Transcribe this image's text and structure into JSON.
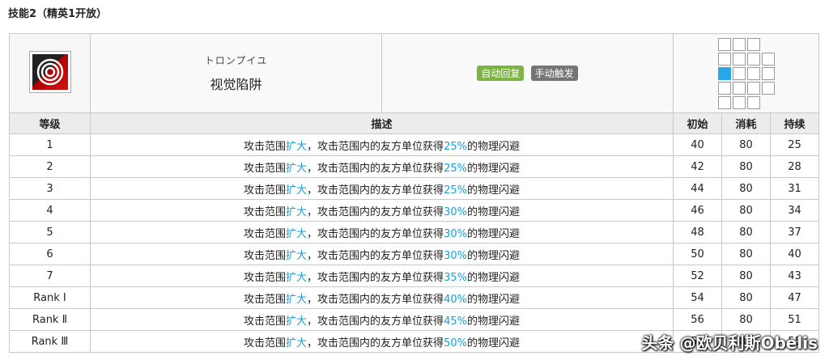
{
  "section_title": "技能2（精英1开放）",
  "skill": {
    "name_jp": "トロンプイユ",
    "name_cn": "视觉陷阱",
    "tags": [
      "自动回复",
      "手动触发"
    ]
  },
  "range_grid": [
    [
      1,
      1,
      1,
      0
    ],
    [
      1,
      1,
      1,
      1
    ],
    [
      2,
      1,
      1,
      1
    ],
    [
      1,
      1,
      1,
      1
    ],
    [
      1,
      1,
      1,
      0
    ]
  ],
  "headers": {
    "level": "等级",
    "description": "描述",
    "initial": "初始",
    "cost": "消耗",
    "duration": "持续"
  },
  "rows": [
    {
      "level": "1",
      "desc_pre": "攻击范围",
      "desc_hl1": "扩大",
      "desc_mid": "，攻击范围内的友方单位获得",
      "desc_hl2": "25%",
      "desc_post": "的物理闪避",
      "initial": "40",
      "cost": "80",
      "duration": "25"
    },
    {
      "level": "2",
      "desc_pre": "攻击范围",
      "desc_hl1": "扩大",
      "desc_mid": "，攻击范围内的友方单位获得",
      "desc_hl2": "25%",
      "desc_post": "的物理闪避",
      "initial": "42",
      "cost": "80",
      "duration": "28"
    },
    {
      "level": "3",
      "desc_pre": "攻击范围",
      "desc_hl1": "扩大",
      "desc_mid": "，攻击范围内的友方单位获得",
      "desc_hl2": "25%",
      "desc_post": "的物理闪避",
      "initial": "44",
      "cost": "80",
      "duration": "31"
    },
    {
      "level": "4",
      "desc_pre": "攻击范围",
      "desc_hl1": "扩大",
      "desc_mid": "，攻击范围内的友方单位获得",
      "desc_hl2": "30%",
      "desc_post": "的物理闪避",
      "initial": "46",
      "cost": "80",
      "duration": "34"
    },
    {
      "level": "5",
      "desc_pre": "攻击范围",
      "desc_hl1": "扩大",
      "desc_mid": "，攻击范围内的友方单位获得",
      "desc_hl2": "30%",
      "desc_post": "的物理闪避",
      "initial": "48",
      "cost": "80",
      "duration": "37"
    },
    {
      "level": "6",
      "desc_pre": "攻击范围",
      "desc_hl1": "扩大",
      "desc_mid": "，攻击范围内的友方单位获得",
      "desc_hl2": "30%",
      "desc_post": "的物理闪避",
      "initial": "50",
      "cost": "80",
      "duration": "40"
    },
    {
      "level": "7",
      "desc_pre": "攻击范围",
      "desc_hl1": "扩大",
      "desc_mid": "，攻击范围内的友方单位获得",
      "desc_hl2": "35%",
      "desc_post": "的物理闪避",
      "initial": "52",
      "cost": "80",
      "duration": "43"
    },
    {
      "level": "Rank Ⅰ",
      "desc_pre": "攻击范围",
      "desc_hl1": "扩大",
      "desc_mid": "，攻击范围内的友方单位获得",
      "desc_hl2": "40%",
      "desc_post": "的物理闪避",
      "initial": "54",
      "cost": "80",
      "duration": "47"
    },
    {
      "level": "Rank Ⅱ",
      "desc_pre": "攻击范围",
      "desc_hl1": "扩大",
      "desc_mid": "，攻击范围内的友方单位获得",
      "desc_hl2": "45%",
      "desc_post": "的物理闪避",
      "initial": "56",
      "cost": "80",
      "duration": "51"
    },
    {
      "level": "Rank Ⅲ",
      "desc_pre": "攻击范围",
      "desc_hl1": "扩大",
      "desc_mid": "，攻击范围内的友方单位获得",
      "desc_hl2": "50%",
      "desc_post": "的物理闪避",
      "initial": "58",
      "cost": "80",
      "duration": "55"
    }
  ],
  "watermark": "头条 @欧贝利斯Obelis",
  "colors": {
    "highlight": "#1a9fd8",
    "tag_auto": "#7cb342",
    "tag_manual": "#757575",
    "range_self": "#2aa7e8"
  },
  "icons": {
    "skill": "red-spiral-skill-icon"
  }
}
